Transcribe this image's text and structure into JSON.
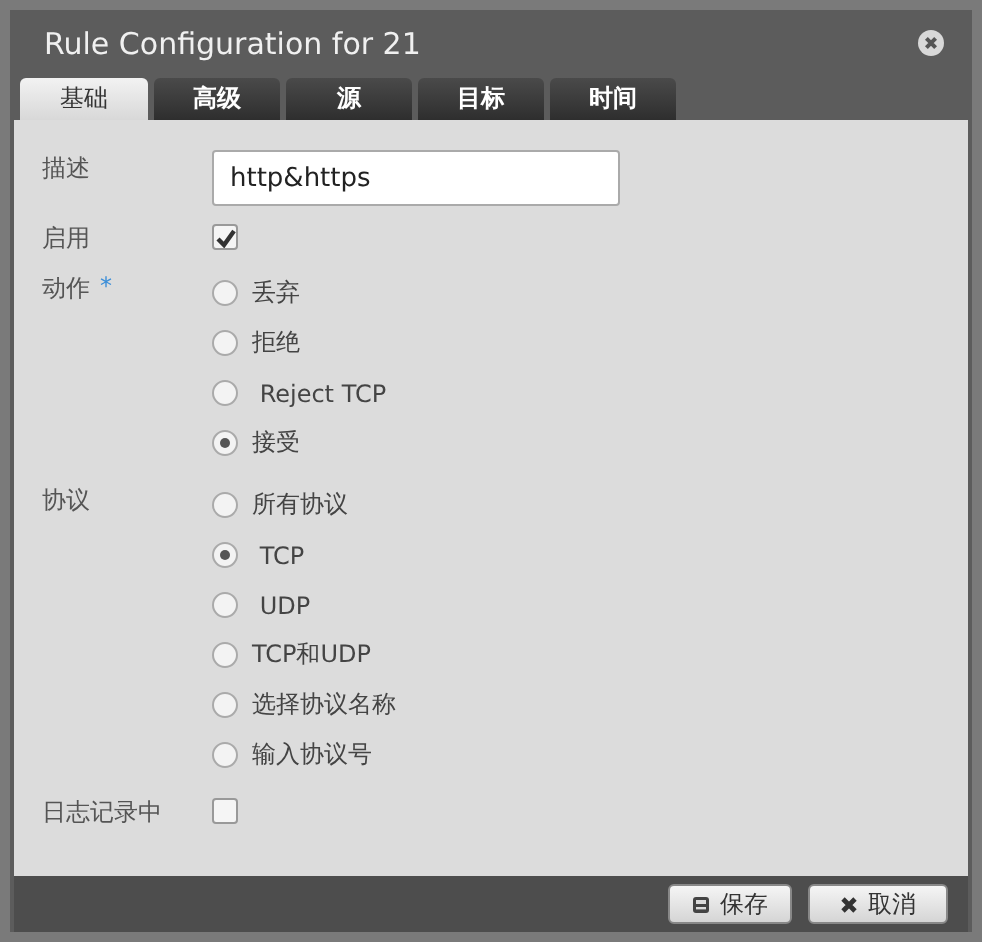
{
  "dialog": {
    "title": "Rule Configuration for 21"
  },
  "tabs": [
    {
      "label": "基础",
      "selected": true
    },
    {
      "label": "高级",
      "selected": false
    },
    {
      "label": "源",
      "selected": false
    },
    {
      "label": "目标",
      "selected": false
    },
    {
      "label": "时间",
      "selected": false
    }
  ],
  "form": [
    {
      "kind": "text",
      "label": "描述",
      "value": "http&https"
    },
    {
      "kind": "checkbox",
      "label": "启用",
      "checked": true
    },
    {
      "kind": "radio",
      "label": "动作",
      "required_mark": "*",
      "options": [
        {
          "label": "丢弃",
          "selected": false
        },
        {
          "label": "拒绝",
          "selected": false
        },
        {
          "label": " Reject TCP",
          "selected": false
        },
        {
          "label": "接受",
          "selected": true
        }
      ]
    },
    {
      "kind": "radio",
      "label": "协议",
      "options": [
        {
          "label": "所有协议",
          "selected": false
        },
        {
          "label": " TCP",
          "selected": true
        },
        {
          "label": " UDP",
          "selected": false
        },
        {
          "label": "TCP和UDP",
          "selected": false
        },
        {
          "label": "选择协议名称",
          "selected": false
        },
        {
          "label": "输入协议号",
          "selected": false
        }
      ]
    },
    {
      "kind": "checkbox",
      "label": "日志记录中",
      "checked": false
    }
  ],
  "buttons": [
    {
      "kind": "save",
      "label": "保存"
    },
    {
      "kind": "cancel",
      "label": "取消"
    }
  ]
}
